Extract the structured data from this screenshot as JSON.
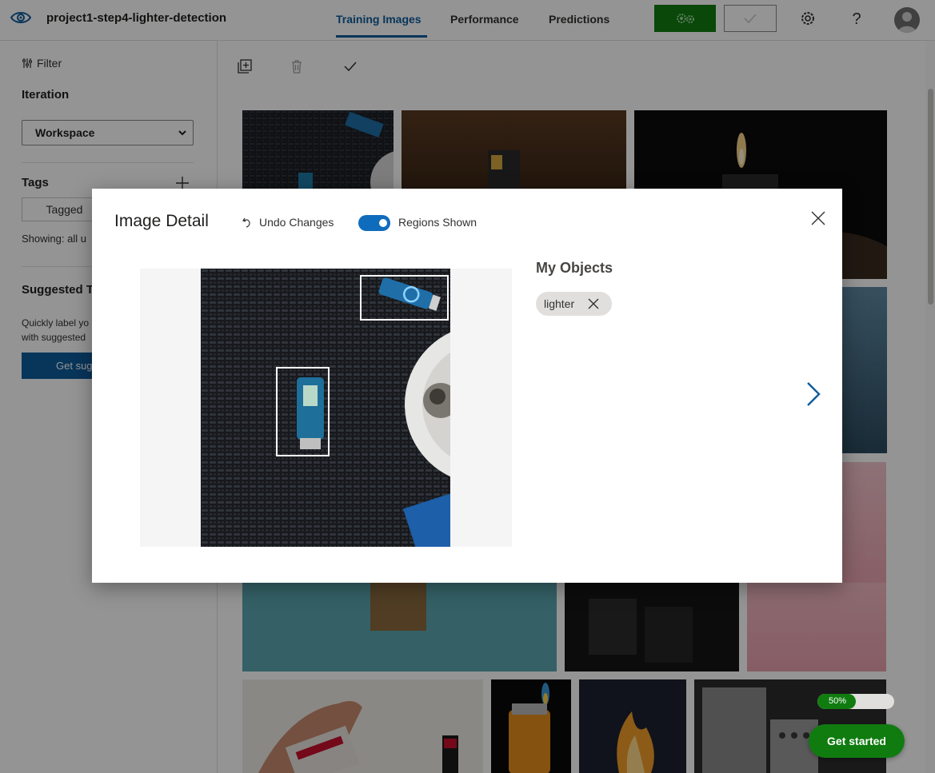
{
  "header": {
    "project_title": "project1-step4-lighter-detection",
    "tabs": [
      {
        "label": "Training Images",
        "active": true
      },
      {
        "label": "Performance",
        "active": false
      },
      {
        "label": "Predictions",
        "active": false
      }
    ],
    "train_icon": "gears-icon",
    "quick_test_icon": "checkmark-icon",
    "settings_icon": "gear-icon",
    "help_label": "?",
    "avatar_icon": "person-icon"
  },
  "sidebar": {
    "filter_label": "Filter",
    "iteration_heading": "Iteration",
    "iteration_value": "Workspace",
    "tags_heading": "Tags",
    "tagged_label": "Tagged",
    "showing_text": "Showing: all u",
    "suggested_heading": "Suggested T",
    "suggested_hint_line1": "Quickly label yo",
    "suggested_hint_line2": "with suggested",
    "suggested_button": "Get sug"
  },
  "toolbar": {
    "icons": [
      "add-images-icon",
      "delete-icon",
      "select-all-icon"
    ]
  },
  "modal": {
    "title": "Image Detail",
    "undo_label": "Undo Changes",
    "regions_label": "Regions Shown",
    "regions_on": true,
    "objects_heading": "My Objects",
    "tags": [
      "lighter"
    ]
  },
  "widget": {
    "progress": 0.5,
    "progress_label": "50%",
    "get_started_label": "Get started"
  },
  "colors": {
    "accent": "#0f5c9c",
    "train_green": "#107c10",
    "toggle_blue": "#0f6cbd"
  }
}
